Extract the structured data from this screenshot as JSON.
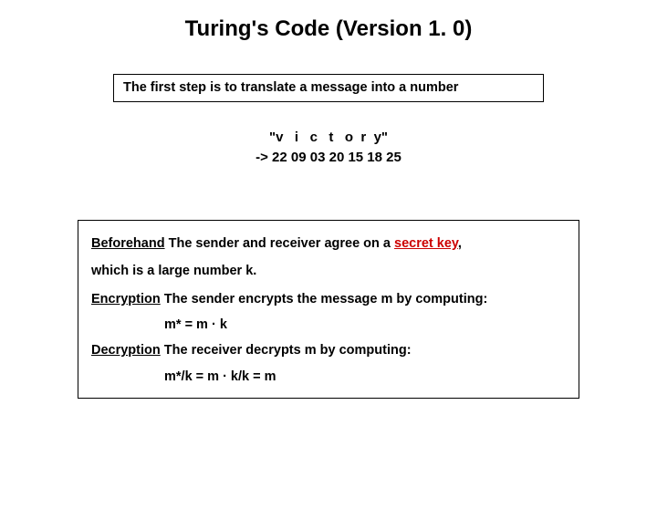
{
  "title": "Turing's Code (Version 1. 0)",
  "intro": "The first step is to translate a message into a number",
  "encoding": {
    "letters": "\"v   i   c   t   o  r  y\"",
    "numbers": "-> 22 09 03 20 15 18 25"
  },
  "steps": {
    "beforehand_label": "Beforehand",
    "beforehand_text1": " The sender and receiver agree on a ",
    "secret_key": "secret key",
    "beforehand_text2": ",",
    "beforehand_line2": "which is a large number k.",
    "encryption_label": "Encryption",
    "encryption_text": " The sender encrypts the message m by computing:",
    "encryption_formula": "m* = m · k",
    "decryption_label": "Decryption",
    "decryption_text": " The receiver decrypts m by computing:",
    "decryption_formula": "m*/k = m · k/k = m"
  }
}
